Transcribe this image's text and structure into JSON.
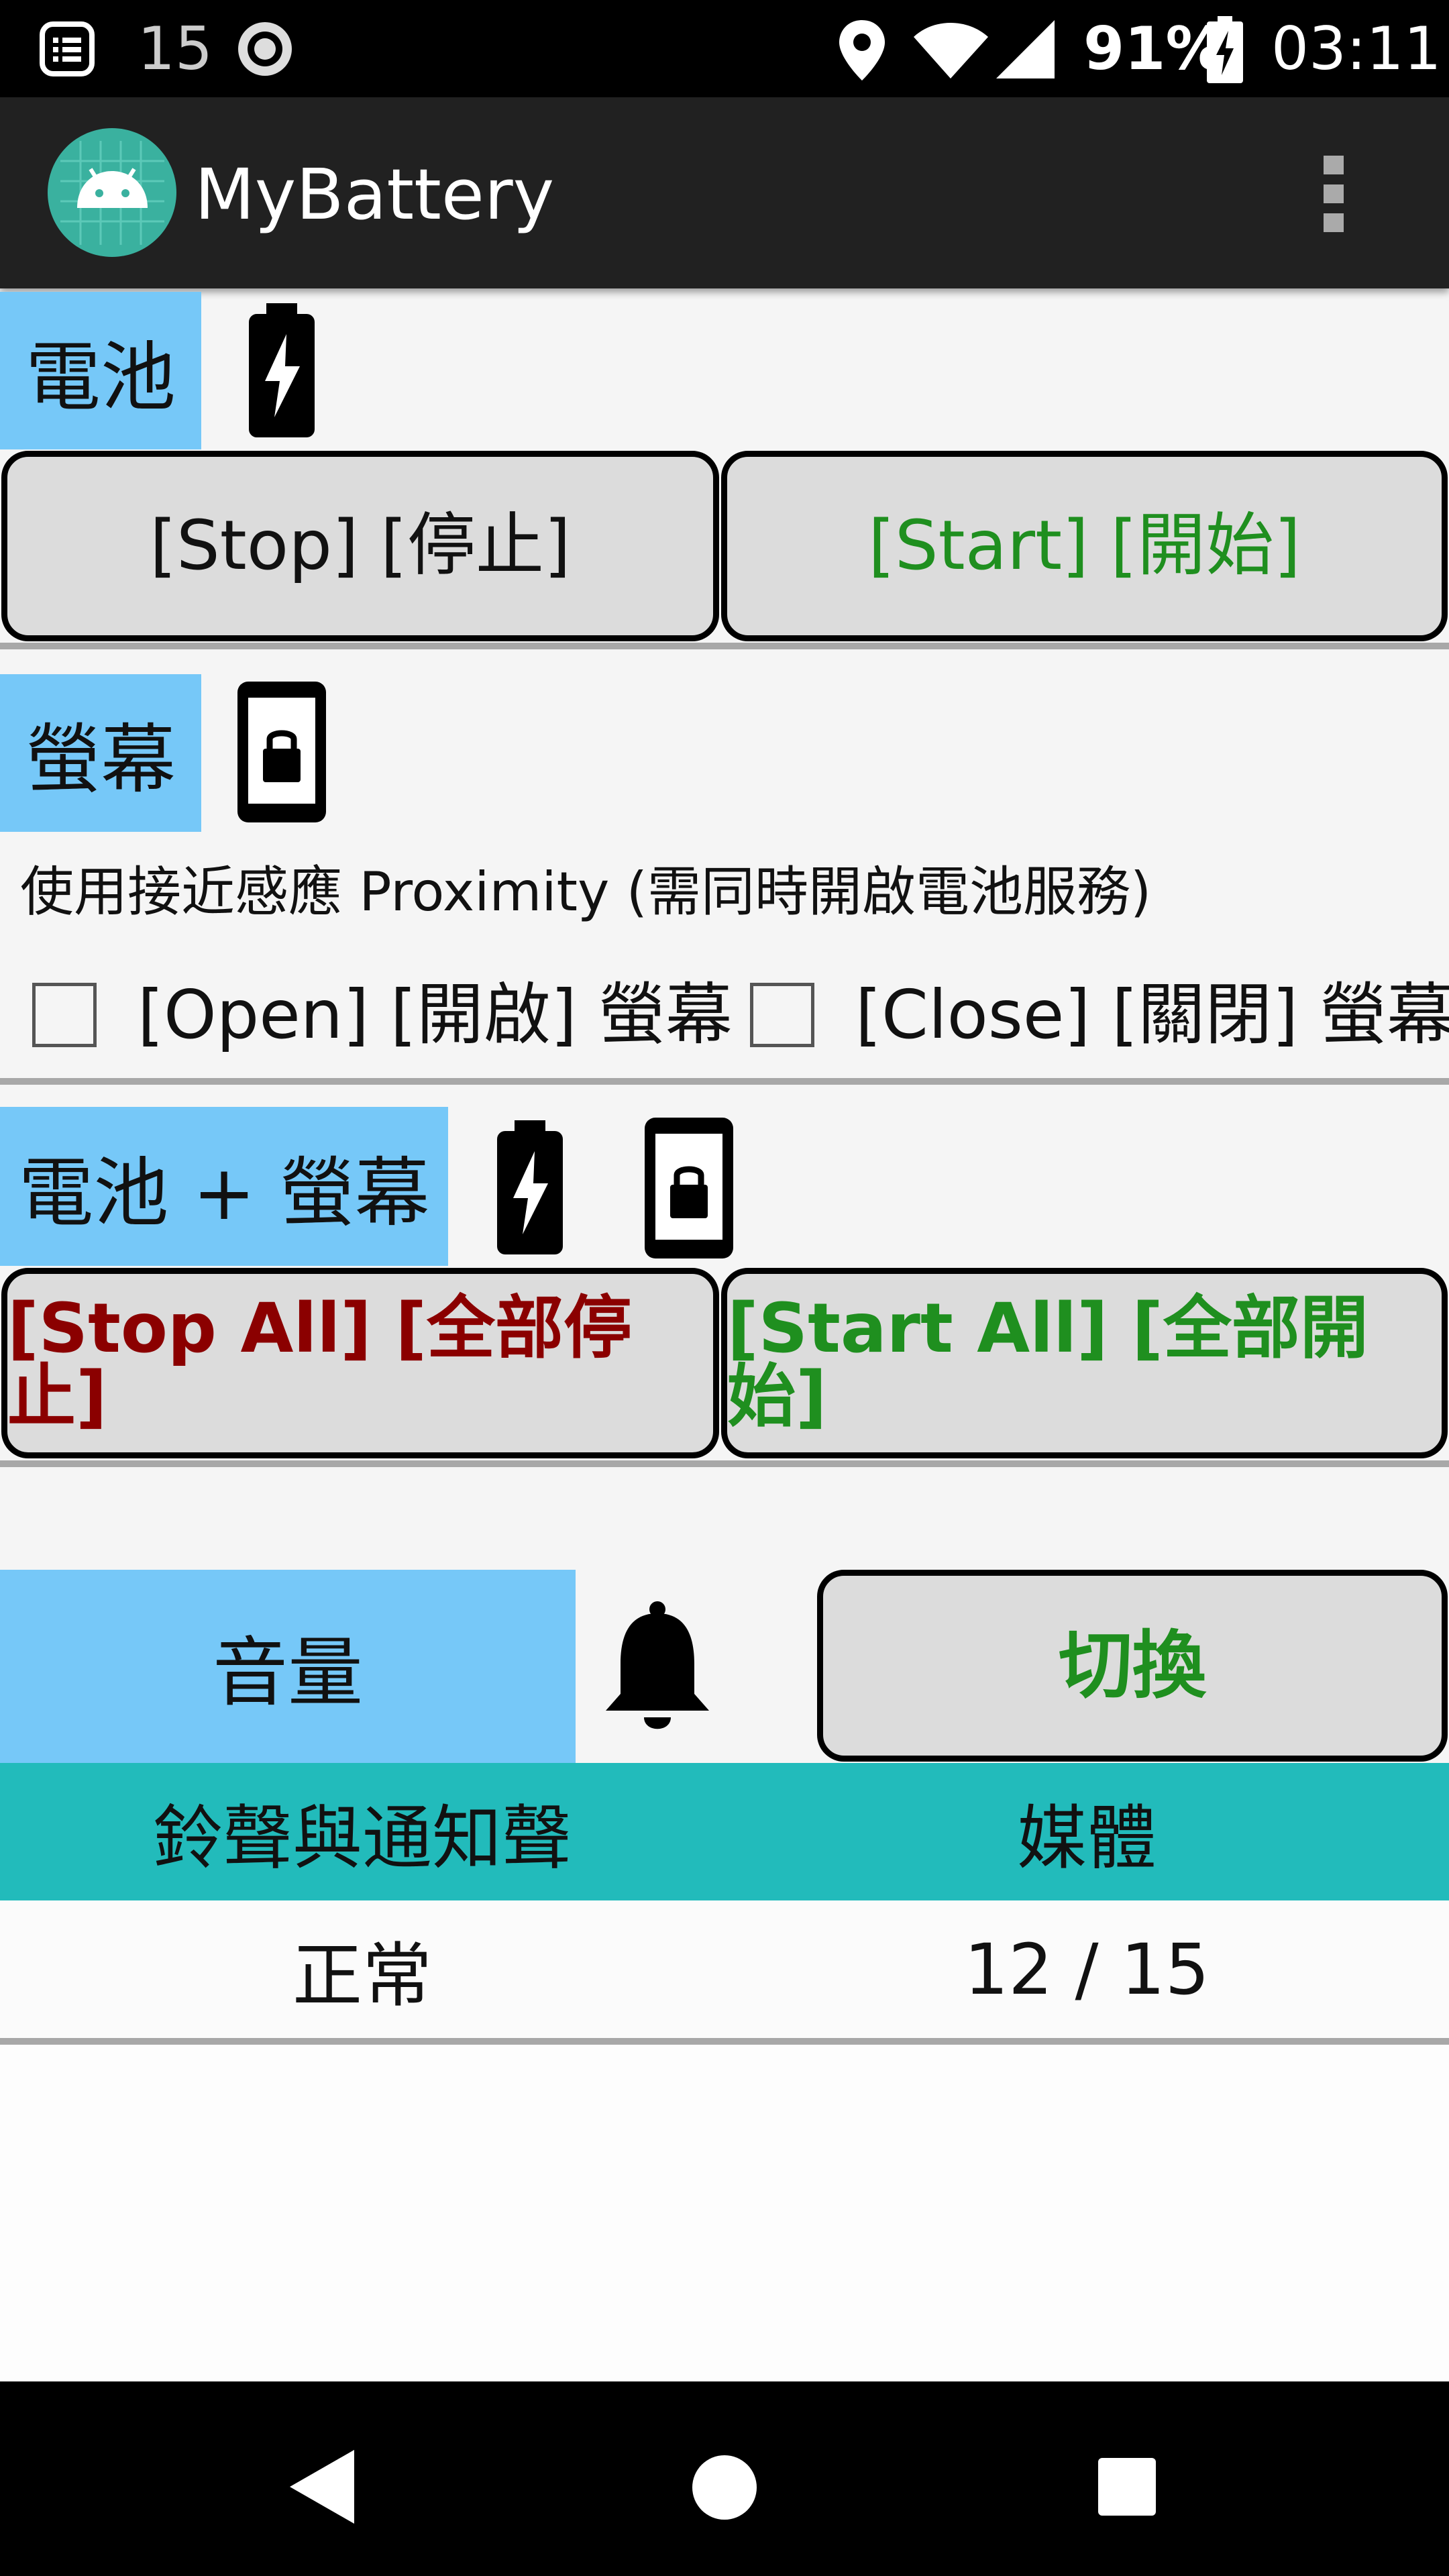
{
  "status_bar": {
    "notification_count": "15",
    "battery_percent": "91%",
    "time": "03:11"
  },
  "app_bar": {
    "title": "MyBattery",
    "icons": [
      "android-app-icon",
      "overflow-menu-icon"
    ]
  },
  "battery_section": {
    "label": "電池",
    "icon": "battery-charging-icon",
    "stop_button": "[Stop] [停止]",
    "start_button": "[Start] [開始]"
  },
  "screen_section": {
    "label": "螢幕",
    "icon": "phone-lock-icon",
    "description": "使用接近感應 Proximity (需同時開啟電池服務)",
    "open_checkbox_label": "[Open] [開啟] 螢幕",
    "open_checked": false,
    "close_checkbox_label": "[Close] [關閉] 螢幕",
    "close_checked": false
  },
  "combined_section": {
    "label": "電池 + 螢幕",
    "stop_all_button": "[Stop All] [全部停止]",
    "start_all_button": "[Start All] [全部開始]"
  },
  "volume_section": {
    "label": "音量",
    "icon": "bell-icon",
    "toggle_button": "切換",
    "table": {
      "headers": [
        "鈴聲與通知聲",
        "媒體"
      ],
      "rows": [
        [
          "正常",
          "12 / 15"
        ]
      ]
    }
  },
  "colors": {
    "label_bg": "#76c8f8",
    "start_text": "#1f8f1f",
    "stop_all_text": "#8b0000",
    "table_header_bg": "#22bbbb"
  }
}
